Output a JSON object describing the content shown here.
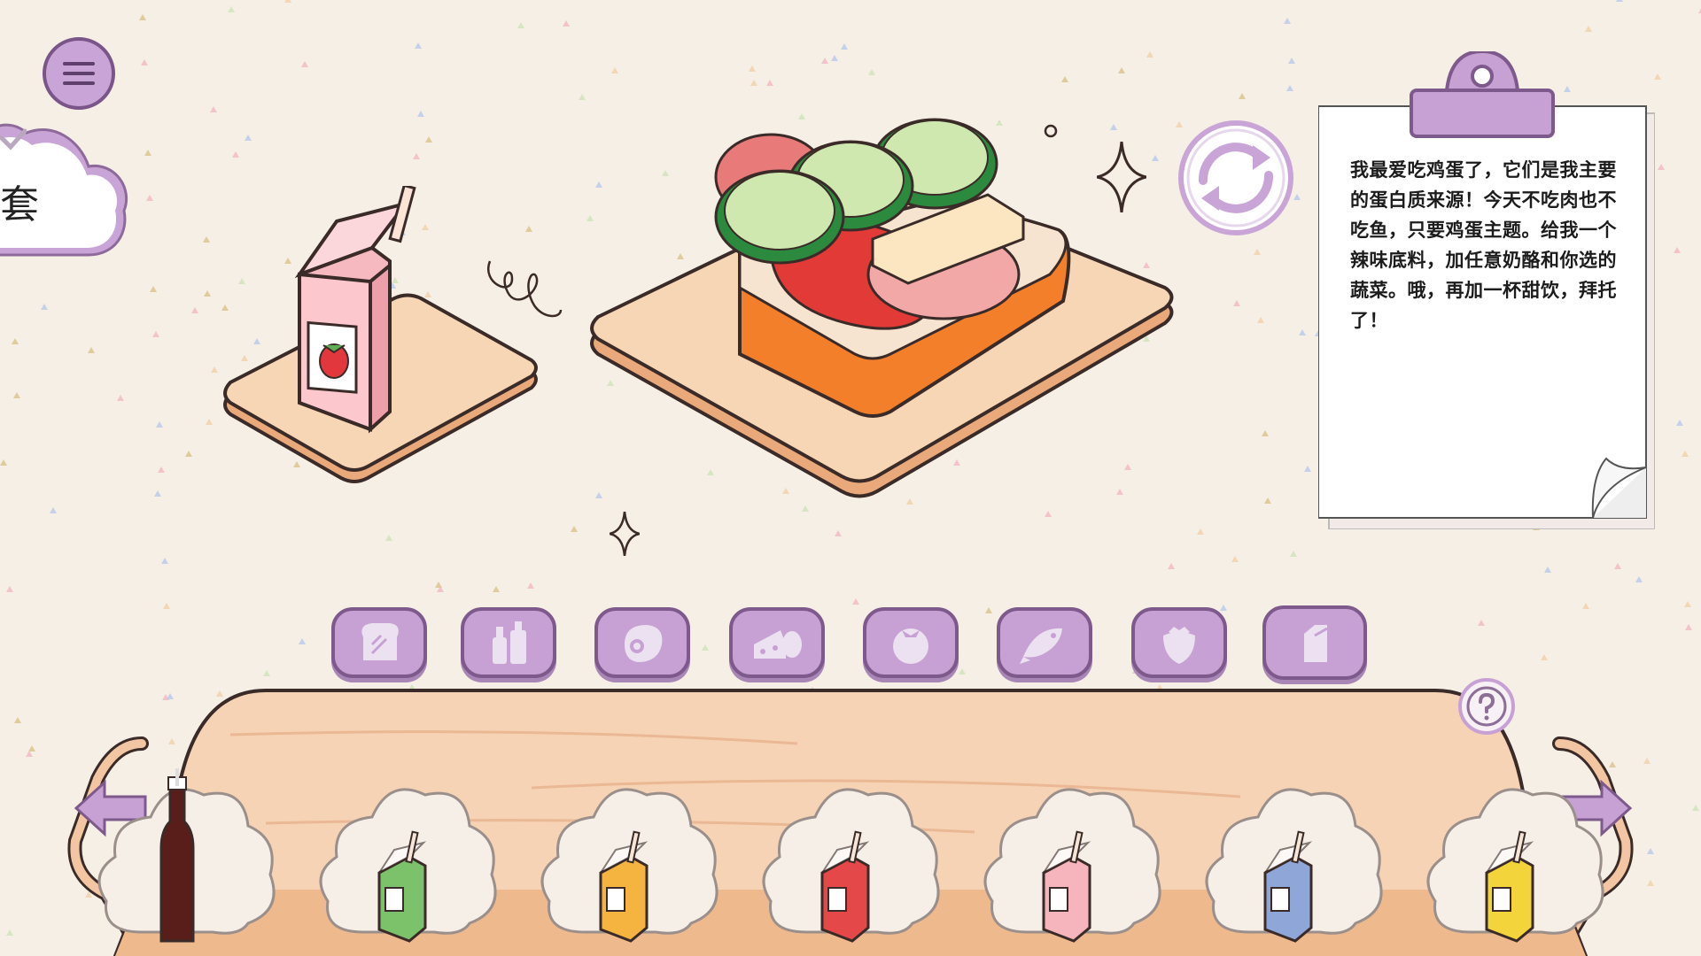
{
  "order_badge": {
    "visible_char": "套"
  },
  "clipboard": {
    "lines": [
      "我最爱吃鸡蛋了，它们是我主要",
      "的蛋白质来源！今天不吃肉也不",
      "吃鱼，只要鸡蛋主题。给我一个",
      "辣味底料，加任意奶酪和你选的",
      "蔬菜。哦，再加一杯甜饮，拜托",
      "了！"
    ]
  },
  "categories": [
    {
      "name": "bread",
      "icon": "bread-icon"
    },
    {
      "name": "sauce",
      "icon": "sauce-bottles-icon"
    },
    {
      "name": "meat",
      "icon": "meat-icon"
    },
    {
      "name": "cheese-egg",
      "icon": "cheese-egg-icon"
    },
    {
      "name": "vegetable",
      "icon": "tomato-icon"
    },
    {
      "name": "fish",
      "icon": "fish-icon"
    },
    {
      "name": "fruit",
      "icon": "strawberry-icon"
    },
    {
      "name": "drink",
      "icon": "drink-carton-icon"
    }
  ],
  "drinks": [
    {
      "name": "cola",
      "icon": "cola-bottle-icon",
      "color": "#5a1e1a"
    },
    {
      "name": "apple-juice",
      "icon": "apple-carton-icon",
      "color": "#7cc26a"
    },
    {
      "name": "orange-juice",
      "icon": "orange-carton-icon",
      "color": "#f5b340"
    },
    {
      "name": "cherry-juice",
      "icon": "cherry-carton-icon",
      "color": "#e54848"
    },
    {
      "name": "strawberry-milk",
      "icon": "strawberry-carton-icon",
      "color": "#f6b4bd"
    },
    {
      "name": "berry-juice",
      "icon": "berry-carton-icon",
      "color": "#8fa6d8"
    },
    {
      "name": "banana-milk",
      "icon": "banana-carton-icon",
      "color": "#f3d43b"
    }
  ],
  "colors": {
    "accent_purple": "#c7a1d4",
    "purple_border": "#7e5a8c",
    "background": "#f6efe6",
    "wood": "#f2c9a4"
  }
}
